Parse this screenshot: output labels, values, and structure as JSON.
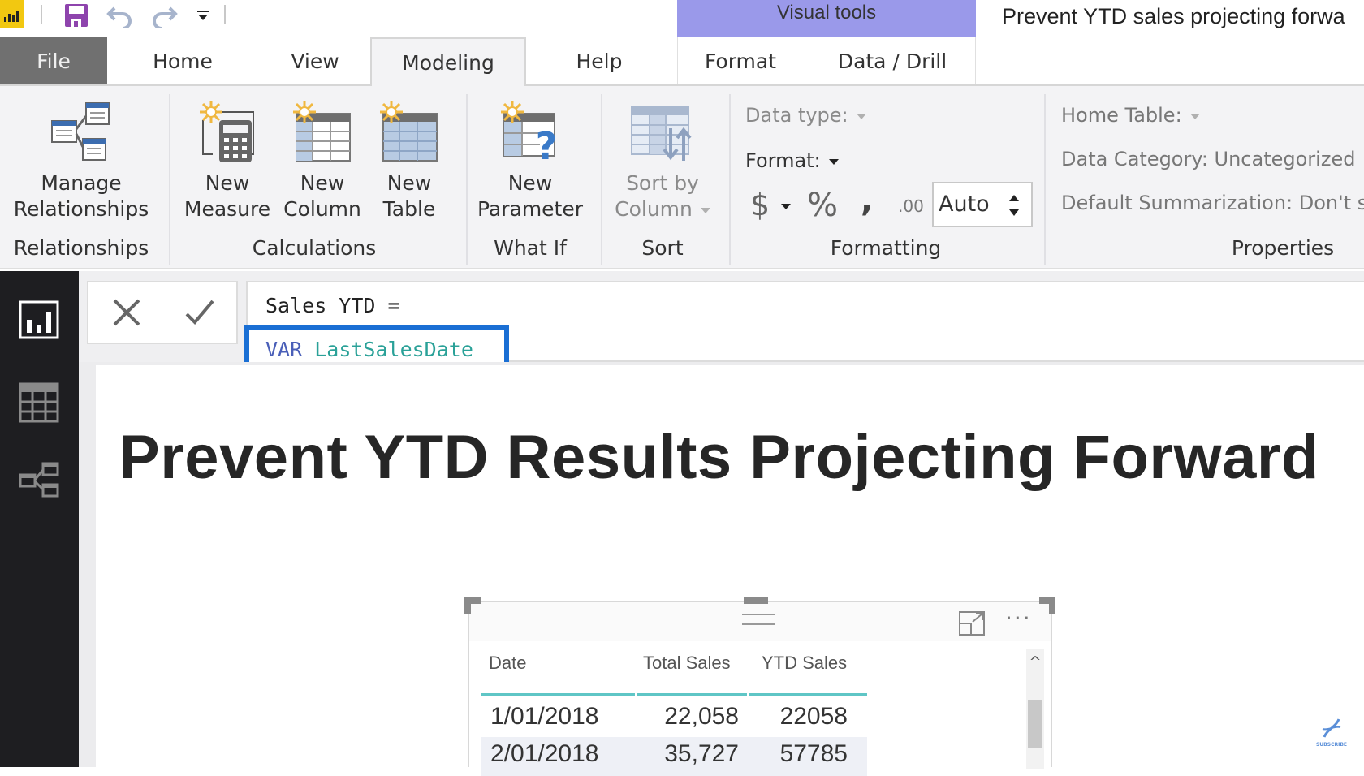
{
  "titlebar": {
    "app_icon": "power-bi-logo",
    "quick_access": [
      {
        "name": "save-icon"
      },
      {
        "name": "undo-icon"
      },
      {
        "name": "redo-icon"
      },
      {
        "name": "customize-quick-access-icon"
      }
    ],
    "context_band_label": "Visual tools",
    "document_title": "Prevent YTD sales projecting forwa"
  },
  "tabs": [
    {
      "label": "File"
    },
    {
      "label": "Home"
    },
    {
      "label": "View"
    },
    {
      "label": "Modeling",
      "active": true
    },
    {
      "label": "Help"
    },
    {
      "label": "Format"
    },
    {
      "label": "Data / Drill"
    }
  ],
  "ribbon": {
    "relationships": {
      "button_line1": "Manage",
      "button_line2": "Relationships",
      "group_label": "Relationships"
    },
    "calculations": {
      "new_measure": [
        "New",
        "Measure"
      ],
      "new_column": [
        "New",
        "Column"
      ],
      "new_table": [
        "New",
        "Table"
      ],
      "group_label": "Calculations"
    },
    "what_if": {
      "new_parameter": [
        "New",
        "Parameter"
      ],
      "group_label": "What If"
    },
    "sort": {
      "sort_by_column": [
        "Sort by",
        "Column"
      ],
      "group_label": "Sort"
    },
    "formatting": {
      "data_type_label": "Data type:",
      "format_label": "Format:",
      "currency_symbol": "$",
      "percent_symbol": "%",
      "comma_symbol": ",",
      "decimal_symbol": ".00",
      "decimal_places_value": "Auto",
      "group_label": "Formatting"
    },
    "properties": {
      "home_table_label": "Home Table:",
      "data_category": "Data Category: Uncategorized",
      "default_summarization": "Default Summarization: Don't summarize",
      "group_label": "Properties"
    }
  },
  "leftnav": [
    {
      "name": "report-view",
      "active": true
    },
    {
      "name": "data-view"
    },
    {
      "name": "model-view"
    }
  ],
  "formula": {
    "line1": "Sales YTD =",
    "line2_keyword": "VAR",
    "line2_variable": "LastSalesDate"
  },
  "report": {
    "title": "Prevent YTD Results Projecting Forward"
  },
  "table_visual": {
    "columns": [
      "Date",
      "Total Sales",
      "YTD Sales"
    ],
    "rows": [
      [
        "1/01/2018",
        "22,058",
        "22058"
      ],
      [
        "2/01/2018",
        "35,727",
        "57785"
      ]
    ]
  },
  "watermark": {
    "label": "SUBSCRIBE"
  },
  "colors": {
    "visual_tools_band": "#9a99ea",
    "highlight_border": "#1a6fd4",
    "dax_keyword": "#4a5fb8",
    "dax_variable": "#2aa198",
    "table_header_underline": "#5fc6c6",
    "powerbi_yellow": "#f2c811"
  }
}
